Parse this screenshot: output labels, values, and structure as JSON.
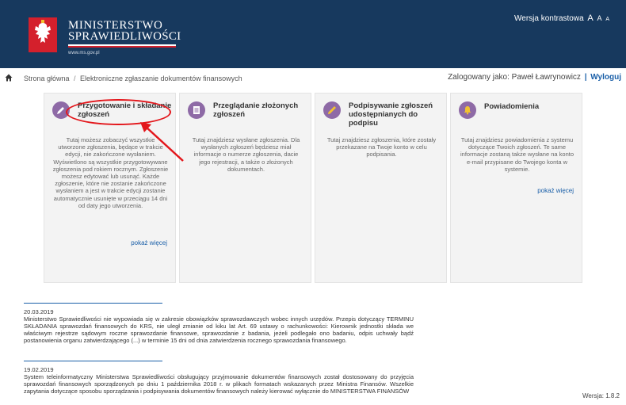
{
  "header": {
    "brand_line1": "MINISTERSTWO",
    "brand_line2": "SPRAWIEDLIWOŚCI",
    "brand_url": "www.ms.gov.pl",
    "contrast_label": "Wersja kontrastowa",
    "font_sizes": [
      "A",
      "A",
      "A"
    ]
  },
  "breadcrumb": {
    "home": "Strona główna",
    "current": "Elektroniczne zgłaszanie dokumentów finansowych"
  },
  "user": {
    "logged_text": "Zalogowany jako: Paweł Ławrynowicz",
    "separator": "|",
    "logout": "Wyloguj"
  },
  "cards": [
    {
      "title": "Przygotowanie i składanie zgłoszeń",
      "icon": "pencil-icon",
      "desc": "Tutaj możesz zobaczyć wszystkie utworzone zgłoszenia, będące w trakcie edycji, nie zakończone wysłaniem. Wyświetlono są wszystkie przygotowywane zgłoszenia pod rokiem rocznym. Zgłoszenie możesz edytować lub usunąć. Każde zgłoszenie, które nie zostanie zakończone wysłaniem a jest w trakcie edycji zostanie automatycznie usunięte w przeciągu 14 dni od daty jego utworzenia.",
      "more": "pokaż więcej"
    },
    {
      "title": "Przeglądanie złożonych zgłoszeń",
      "icon": "document-icon",
      "desc": "Tutaj znajdziesz wysłane zgłoszenia. Dla wysłanych zgłoszeń będziesz miał informacje o numerze zgłoszenia, dacie jego rejestracji, a także o złożonych dokumentach.",
      "more": ""
    },
    {
      "title": "Podpisywanie zgłoszeń udostępnianych do podpisu",
      "icon": "pen-icon",
      "desc": "Tutaj znajdziesz zgłoszenia, które zostały przekazane na Twoje konto w celu podpisania.",
      "more": ""
    },
    {
      "title": "Powiadomienia",
      "icon": "bell-icon",
      "desc": "Tutaj znajdziesz powiadomienia z systemu dotyczące Twoich zgłoszeń. Te same informacje zostaną także wysłane na konto e-mail przypisane do Twojego konta w systemie.",
      "more": "pokaż więcej"
    }
  ],
  "news": [
    {
      "date": "20.03.2019",
      "text": "Ministerstwo Sprawiedliwości nie wypowiada się w zakresie obowiązków sprawozdawczych wobec innych urzędów. Przepis dotyczący TERMINU SKŁADANIA sprawozdań finansowych do KRS, nie uległ zmianie od kiku lat Art. 69 ustawy o rachunkowości: Kierownik jednostki składa we właściwym rejestrze sądowym roczne sprawozdanie finansowe, sprawozdanie z badania, jeżeli podlegało ono badaniu, odpis uchwały bądź postanowienia organu zatwierdzającego (...) w terminie 15 dni od dnia zatwierdzenia rocznego sprawozdania finansowego."
    },
    {
      "date": "19.02.2019",
      "text": "System teleinformatyczny Ministerstwa Sprawiedliwości obsługujący przyjmowanie dokumentów finansowych został dostosowany do przyjęcia sprawozdań finansowych sporządzonych po dniu 1 października 2018 r. w plikach formatach wskazanych przez Ministra Finansów. Wszelkie zapytania dotyczące sposobu sporządzania i podpisywania dokumentów finansowych należy kierować wyłącznie do MINISTERSTWA FINANSÓW"
    }
  ],
  "version": "Wersja: 1.8.2"
}
